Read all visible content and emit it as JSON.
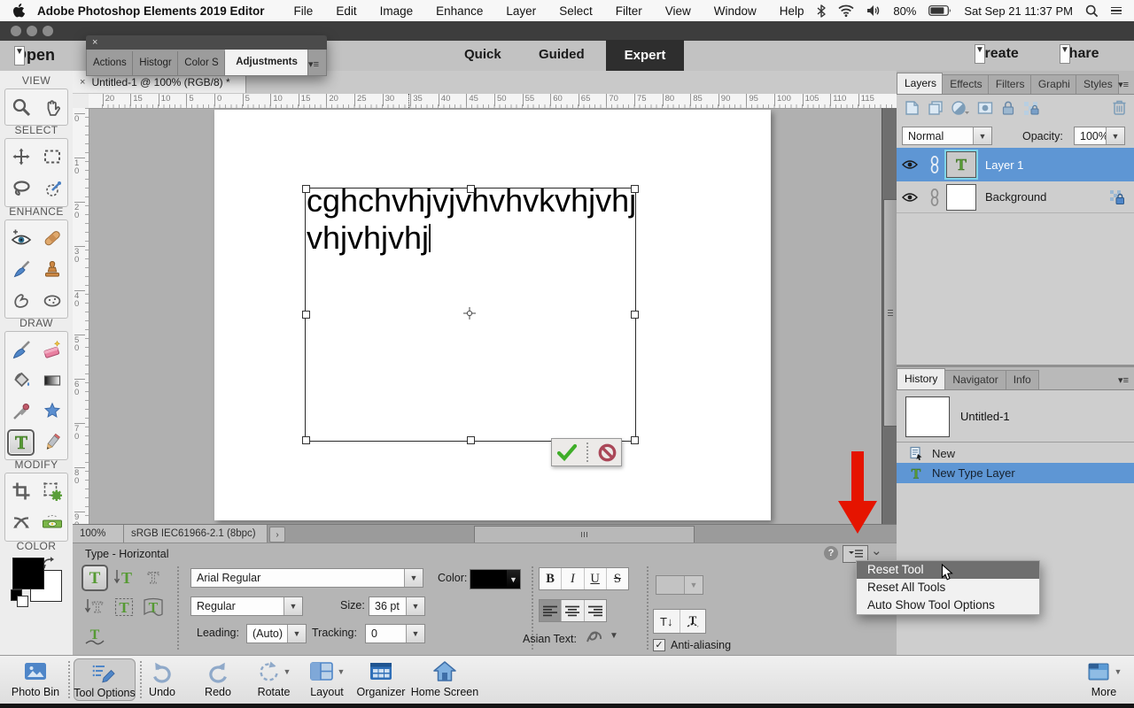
{
  "menubar": {
    "app_name": "Adobe Photoshop Elements 2019 Editor",
    "menus": [
      "File",
      "Edit",
      "Image",
      "Enhance",
      "Layer",
      "Select",
      "Filter",
      "View",
      "Window",
      "Help"
    ],
    "battery_percent": "80%",
    "clock": "Sat Sep 21 11:37 PM"
  },
  "header": {
    "open_label": "Open",
    "quick_label": "Quick",
    "guided_label": "Guided",
    "expert_label": "Expert",
    "create_label": "Create",
    "share_label": "Share"
  },
  "floating_panel": {
    "close_label": "×",
    "tabs": [
      "Actions",
      "Histogr",
      "Color S",
      "Adjustments"
    ]
  },
  "document_tab": {
    "close_label": "×",
    "title": "Untitled-1 @ 100% (RGB/8) *"
  },
  "toolbox": {
    "section_labels": [
      "VIEW",
      "SELECT",
      "ENHANCE",
      "DRAW",
      "MODIFY",
      "COLOR"
    ]
  },
  "rulers": {
    "horizontal": [
      "20",
      "15",
      "10",
      "5",
      "0",
      "5",
      "10",
      "15",
      "20",
      "25",
      "30",
      "35",
      "40",
      "45",
      "50",
      "55",
      "60",
      "65",
      "70",
      "75",
      "80",
      "85",
      "90",
      "95",
      "100",
      "105",
      "110",
      "115"
    ],
    "vertical": [
      "0",
      "10",
      "20",
      "30",
      "40",
      "50",
      "60",
      "70",
      "80",
      "90"
    ]
  },
  "canvas": {
    "text_line1": "cghchvhjvjvhvhvkvhjvhj",
    "text_line2": "vhjvhjvhj"
  },
  "statusbar": {
    "zoom_level": "100%",
    "color_profile": "sRGB IEC61966-2.1 (8bpc)",
    "profile_expander": "›"
  },
  "tool_options": {
    "title": "Type - Horizontal",
    "font_family": "Arial Regular",
    "font_style": "Regular",
    "size_label": "Size:",
    "size_value": "36 pt",
    "leading_label": "Leading:",
    "leading_value": "(Auto)",
    "tracking_label": "Tracking:",
    "tracking_value": "0",
    "color_label": "Color:",
    "bold_label": "B",
    "italic_label": "I",
    "underline_label": "U",
    "strikethrough_label": "S",
    "asian_text_label": "Asian Text:",
    "anti_aliasing_label": "Anti-aliasing",
    "help_label": "?"
  },
  "context_menu": {
    "items": [
      "Reset Tool",
      "Reset All Tools",
      "Auto Show Tool Options"
    ]
  },
  "layers_panel": {
    "tabs": [
      "Layers",
      "Effects",
      "Filters",
      "Graphi",
      "Styles"
    ],
    "blend_mode": "Normal",
    "opacity_label": "Opacity:",
    "opacity_value": "100%",
    "layers": [
      {
        "name": "Layer 1"
      },
      {
        "name": "Background"
      }
    ]
  },
  "history_panel": {
    "tabs": [
      "History",
      "Navigator",
      "Info"
    ],
    "snapshot_name": "Untitled-1",
    "items": [
      {
        "label": "New"
      },
      {
        "label": "New Type Layer"
      }
    ]
  },
  "taskbar": {
    "items": [
      {
        "label": "Photo Bin"
      },
      {
        "label": "Tool Options"
      },
      {
        "label": "Undo"
      },
      {
        "label": "Redo"
      },
      {
        "label": "Rotate"
      },
      {
        "label": "Layout"
      },
      {
        "label": "Organizer"
      },
      {
        "label": "Home Screen"
      }
    ],
    "more_label": "More"
  },
  "icons": {
    "selection_blue": "#5e96d4",
    "annotation_red": "#e51400",
    "type_tool_green": "#569a34",
    "commit_check_green": "#3fae29",
    "cancel_red": "#aa4758"
  }
}
